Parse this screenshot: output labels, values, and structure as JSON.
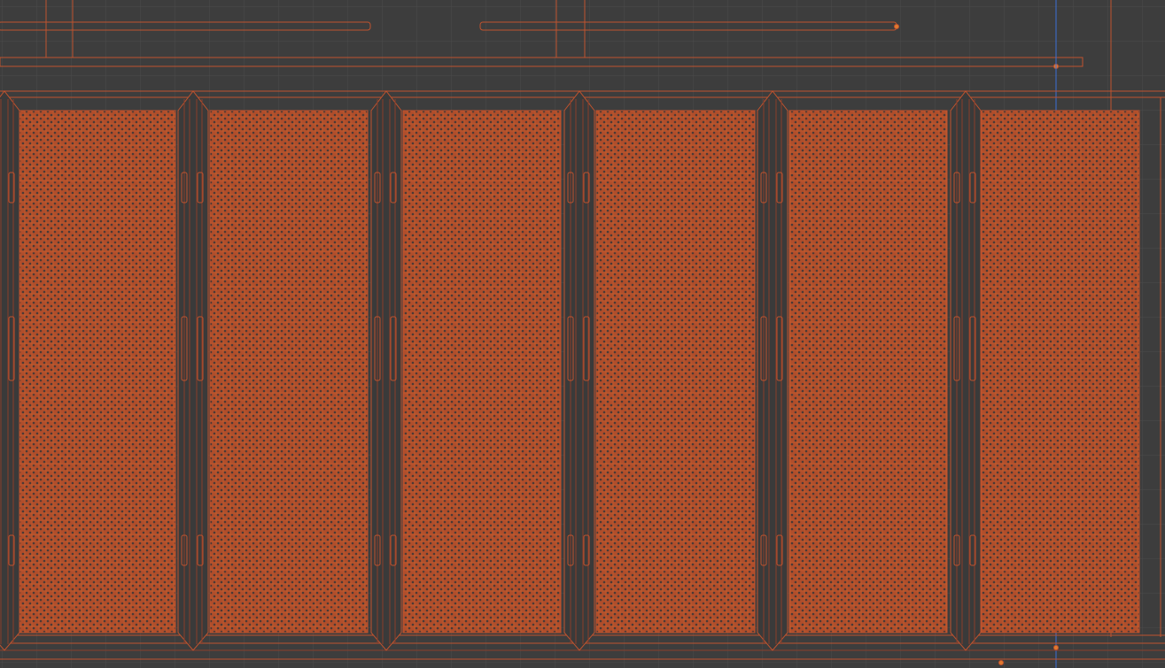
{
  "viewport": {
    "colors": {
      "background": "#3d3d3d",
      "grid": "#4b4b4b",
      "wire": "#c0532e",
      "wire_dim": "#8a3e2a",
      "fill": "#a94a2a",
      "dot": "#4a3a36",
      "axis_blue": "#3a6fd8",
      "vertex": "#e07a2e"
    },
    "panel_count": 6
  }
}
